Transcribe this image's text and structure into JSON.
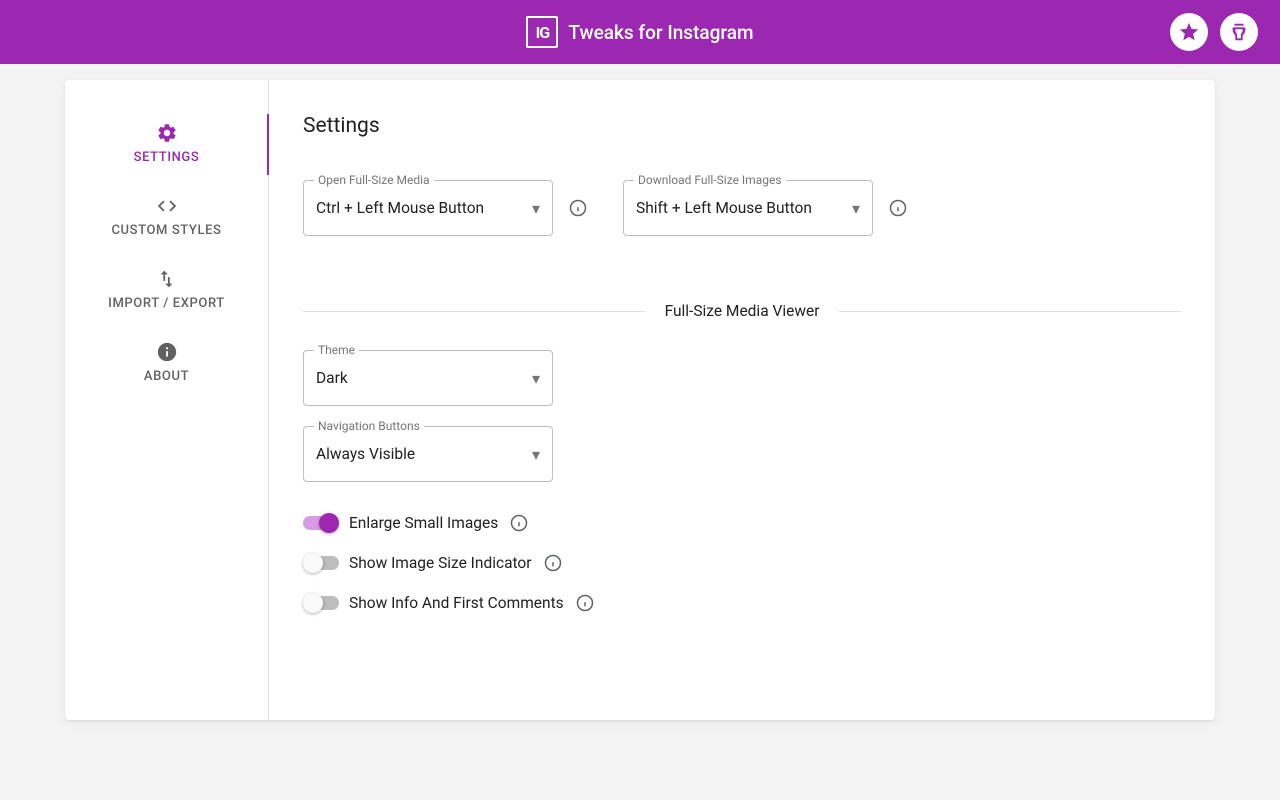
{
  "header": {
    "app_title": "Tweaks for Instagram",
    "logo_text": "IG"
  },
  "sidebar": {
    "items": [
      {
        "label": "SETTINGS",
        "active": true
      },
      {
        "label": "CUSTOM STYLES",
        "active": false
      },
      {
        "label": "IMPORT / EXPORT",
        "active": false
      },
      {
        "label": "ABOUT",
        "active": false
      }
    ]
  },
  "main": {
    "page_title": "Settings",
    "open_media": {
      "label": "Open Full-Size Media",
      "value": "Ctrl + Left Mouse Button"
    },
    "download_media": {
      "label": "Download Full-Size Images",
      "value": "Shift + Left Mouse Button"
    },
    "viewer_section_title": "Full-Size Media Viewer",
    "theme": {
      "label": "Theme",
      "value": "Dark"
    },
    "nav_buttons": {
      "label": "Navigation Buttons",
      "value": "Always Visible"
    },
    "toggles": {
      "enlarge": {
        "label": "Enlarge Small Images",
        "on": true
      },
      "size_indicator": {
        "label": "Show Image Size Indicator",
        "on": false
      },
      "info_comments": {
        "label": "Show Info And First Comments",
        "on": false
      }
    }
  },
  "colors": {
    "accent": "#9c27b0"
  }
}
